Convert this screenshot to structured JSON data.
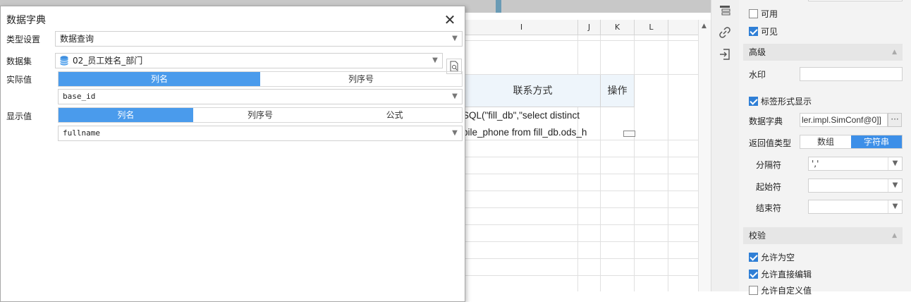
{
  "sheet": {
    "columns": [
      "I",
      "J",
      "K",
      "L"
    ],
    "header_cell": "联系方式",
    "op_cell": "操作",
    "formula_lines": [
      "SQL(\"fill_db\",\"select distinct",
      "bile_phone from fill_db.ods_h"
    ]
  },
  "dialog": {
    "title": "数据字典",
    "type_label": "类型设置",
    "type_value": "数据查询",
    "dataset_label": "数据集",
    "dataset_value": "02_员工姓名_部门",
    "actual_label": "实际值",
    "actual_tabs": [
      "列名",
      "列序号"
    ],
    "actual_value": "base_id",
    "display_label": "显示值",
    "display_tabs": [
      "列名",
      "列序号",
      "公式"
    ],
    "display_value": "fullname"
  },
  "panel": {
    "usable_label": "可用",
    "usable_checked": false,
    "visible_label": "可见",
    "visible_checked": true,
    "advanced_title": "高级",
    "watermark_label": "水印",
    "watermark_value": "",
    "tag_display_label": "标签形式显示",
    "tag_display_checked": true,
    "dict_label": "数据字典",
    "dict_value": "ler.impl.SimConf@0]]",
    "dict_more": "···",
    "return_type_label": "返回值类型",
    "return_type_options": [
      "数组",
      "字符串"
    ],
    "return_type_selected": "字符串",
    "separator_label": "分隔符",
    "separator_value": "','",
    "start_label": "起始符",
    "start_value": "",
    "end_label": "结束符",
    "end_value": "",
    "validate_title": "校验",
    "allow_empty_label": "允许为空",
    "allow_empty_checked": true,
    "allow_edit_label": "允许直接编辑",
    "allow_edit_checked": true,
    "allow_custom_label": "允许自定义值",
    "allow_custom_checked": false
  },
  "colors": {
    "accent": "#4a9bec",
    "check": "#2f7fd6",
    "header_fill": "#eef5fb"
  }
}
